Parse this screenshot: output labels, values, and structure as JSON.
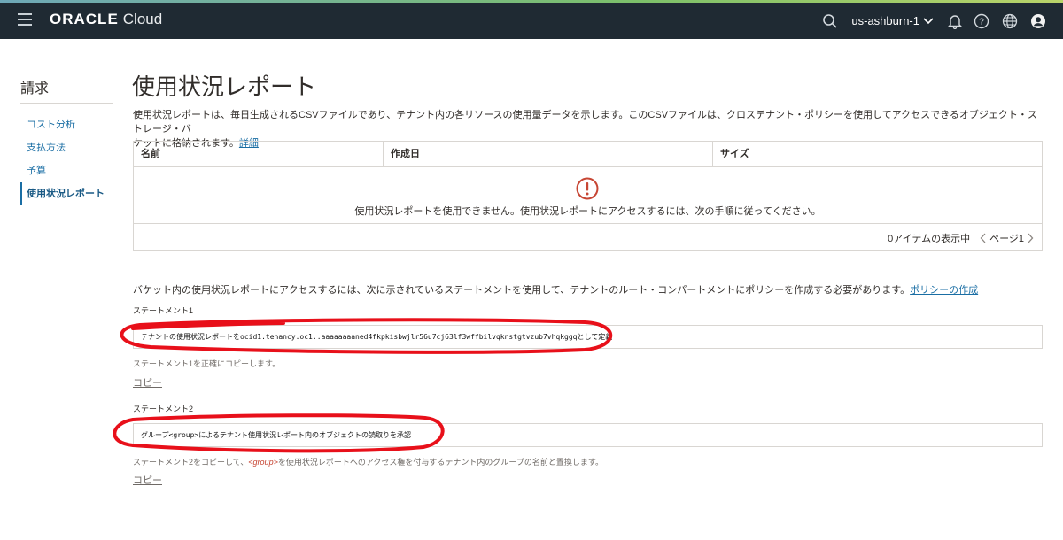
{
  "header": {
    "brand": "ORACLE",
    "product": "Cloud",
    "region": "us-ashburn-1",
    "icons": [
      "menu-icon",
      "search-icon",
      "chevron-down-icon",
      "bell-icon",
      "help-icon",
      "globe-icon",
      "user-icon"
    ],
    "background": "#1f2a33"
  },
  "sidebar": {
    "title": "請求",
    "items": [
      {
        "label": "コスト分析"
      },
      {
        "label": "支払方法"
      },
      {
        "label": "予算"
      },
      {
        "label": "使用状況レポート"
      }
    ],
    "active_index": 3
  },
  "main": {
    "title": "使用状況レポート",
    "description_line1": "使用状況レポートは、毎日生成されるCSVファイルであり、テナント内の各リソースの使用量データを示します。このCSVファイルは、クロステナント・ポリシーを使用してアクセスできるオブジェクト・ストレージ・バ",
    "description_line2": "ケットに格納されます。",
    "description_link": "詳細",
    "table": {
      "columns": [
        "名前",
        "作成日",
        "サイズ"
      ],
      "empty_message": "使用状況レポートを使用できません。使用状況レポートにアクセスするには、次の手順に従ってください。",
      "pager_text": "0アイテムの表示中",
      "page_label": "ページ1"
    },
    "intro_text": "バケット内の使用状況レポートにアクセスするには、次に示されているステートメントを使用して、テナントのルート・コンパートメントにポリシーを作成する必要があります。",
    "intro_link": "ポリシーの作成",
    "statement1": {
      "label": "ステートメント1",
      "value": "テナントの使用状況レポートをocid1.tenancy.oc1..aaaaaaaaned4fkpkisbwjlr56u7cj63lf3wffbilvqknstgtvzub7vhqkggqとして定義",
      "help": "ステートメント1を正確にコピーします。",
      "copy_label": "コピー"
    },
    "statement2": {
      "label": "ステートメント2",
      "value": "グループ<group>によるテナント使用状況レポート内のオブジェクトの読取りを承認",
      "help_before": "ステートメント2をコピーして、",
      "help_group": "<group>",
      "help_after": "を使用状況レポートへのアクセス権を付与するテナント内のグループの名前と置換します。",
      "copy_label": "コピー"
    }
  },
  "colors": {
    "link": "#1a6ea4",
    "error": "#c74634",
    "annotation": "#e8101a"
  }
}
